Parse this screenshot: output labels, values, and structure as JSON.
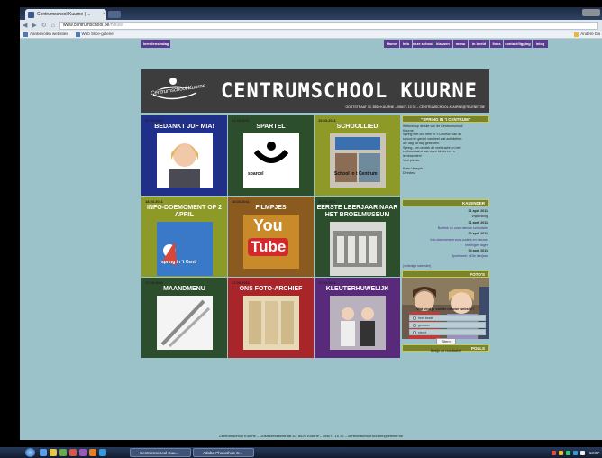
{
  "browser": {
    "tab_title": "Centrumschool Kuurne | ...",
    "address_host": "www.centrumschool.be",
    "address_path": "/nieuw/",
    "bookmarks": [
      "Aanbevolen websites",
      "Web Slice-galerie"
    ],
    "other_bookmarks": "Andere bla"
  },
  "site": {
    "nav_left": "leerdiensindag",
    "nav": [
      "Home",
      "Info",
      "onze school",
      "klassen",
      "menu",
      "in beeld",
      "links",
      "contact/ligging",
      "inlog"
    ],
    "title": "CENTRUMSCHOOL KUURNE",
    "logo_text": "Centrumschool Kuurne",
    "address_line": "OOSTSTRAAT 30, 8520 KUURNE – 056/71 10 32 – CENTRUMSCHOOL.KUURNE@TELENET.BE",
    "tiles": [
      {
        "date": "21.03.2011",
        "title": "BEDANKT JUF MIA!",
        "color": "#1f2f8a",
        "pic": "portrait"
      },
      {
        "date": "21.03.2011",
        "title": "SPARTEL",
        "color": "#2d4e2d",
        "pic": "sparta",
        "caption": "sparcel"
      },
      {
        "date": "19.03.2011",
        "title": "SCHOOLLIED",
        "color": "#8e9a27",
        "pic": "schoollied",
        "caption": "School in t Centrum"
      },
      {
        "date": "18.03.2011",
        "title": "INFO-DOEMOMENT OP 2 APRIL",
        "color": "#8e9a27",
        "pic": "spring",
        "caption": "spring in 't Centr"
      },
      {
        "date": "18.03.2011",
        "title": "FILMPJES",
        "color": "#8a5a1e",
        "pic": "youtube",
        "caption": "You",
        "caption2": "Tube"
      },
      {
        "date": "18.03.2011",
        "title": "EERSTE LEERJAAR NAAR HET BROELMUSEUM",
        "color": "#2d4e2d",
        "pic": "museum"
      },
      {
        "date": "17.03.2011",
        "title": "MAANDMENU",
        "color": "#2d4e2d",
        "pic": "cutlery"
      },
      {
        "date": "17.03.2011",
        "title": "ONS FOTO-ARCHIEF",
        "color": "#a8252a",
        "pic": "archive"
      },
      {
        "date": "17.03.2011",
        "title": "KLEUTERHUWELIJK",
        "color": "#5a2a7a",
        "pic": "kids"
      }
    ],
    "sidebar": {
      "spring_header": "\"SPRING IN 't CENTRUM\"",
      "spring_text": [
        "Welkom op de site van de Centrumschool",
        "Kuurne.",
        "Spring met ons mee in 't Centrum van de",
        "school en geniet van heel wat activiteiten",
        "die dag na dag gebeuren.",
        "Spring... en ontdek de veelkracht en het",
        "enthousiasme van onze kinderen en",
        "leerkrachten!",
        "Veel plezier.",
        "",
        "Koen Vanryck",
        "Directeur"
      ],
      "kalender_header": "KALENDER",
      "kalender": [
        {
          "text": "01 april 2011",
          "kind": "date"
        },
        {
          "text": "Vrijdenking",
          "kind": "plain"
        },
        {
          "text": "01 april 2011",
          "kind": "date"
        },
        {
          "text": "Boetiek op onze nieuwe schoolsite",
          "kind": "link"
        },
        {
          "text": "02 april 2011",
          "kind": "date"
        },
        {
          "text": "Info-doemoment voor ouders en nieuwe",
          "kind": "link"
        },
        {
          "text": "leerlingen lager",
          "kind": "link"
        },
        {
          "text": "04 april 2011",
          "kind": "date"
        },
        {
          "text": "Sportweek: viDte leerjaar",
          "kind": "link"
        }
      ],
      "kalender_all": "(volledige kalender)",
      "fotos_header": "FOTO'S",
      "polls_header": "POLLS",
      "poll_question": "Wat vind je van de nieuwe website?",
      "poll_options": [
        "heel bewie",
        "gewoon",
        "slecht"
      ],
      "vote_label": "Stem",
      "results_label": "Bekijk de resultaten"
    },
    "footer": "Centrumschool Kuurne – Oostrozebekestraat 30, 8520 Kuurne – 056/71 10 32 – centrumschool.kuurne@telenet.be"
  },
  "taskbar": {
    "tasks": [
      "Centrumschool Kuu...",
      "Adobe Photoshop C..."
    ],
    "clock": "13:07"
  }
}
